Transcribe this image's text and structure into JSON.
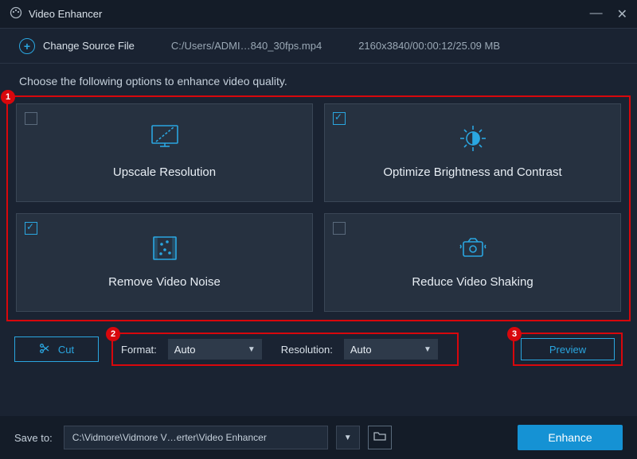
{
  "app": {
    "title": "Video Enhancer"
  },
  "source": {
    "change_label": "Change Source File",
    "path": "C:/Users/ADMI…840_30fps.mp4",
    "meta": "2160x3840/00:00:12/25.09 MB"
  },
  "instructions": "Choose the following options to enhance video quality.",
  "options": [
    {
      "label": "Upscale Resolution",
      "checked": false
    },
    {
      "label": "Optimize Brightness and Contrast",
      "checked": true
    },
    {
      "label": "Remove Video Noise",
      "checked": true
    },
    {
      "label": "Reduce Video Shaking",
      "checked": false
    }
  ],
  "controls": {
    "cut_label": "Cut",
    "format_label": "Format:",
    "format_value": "Auto",
    "resolution_label": "Resolution:",
    "resolution_value": "Auto",
    "preview_label": "Preview"
  },
  "footer": {
    "save_label": "Save to:",
    "save_path": "C:\\Vidmore\\Vidmore V…erter\\Video Enhancer",
    "enhance_label": "Enhance"
  },
  "callouts": {
    "1": "1",
    "2": "2",
    "3": "3"
  }
}
